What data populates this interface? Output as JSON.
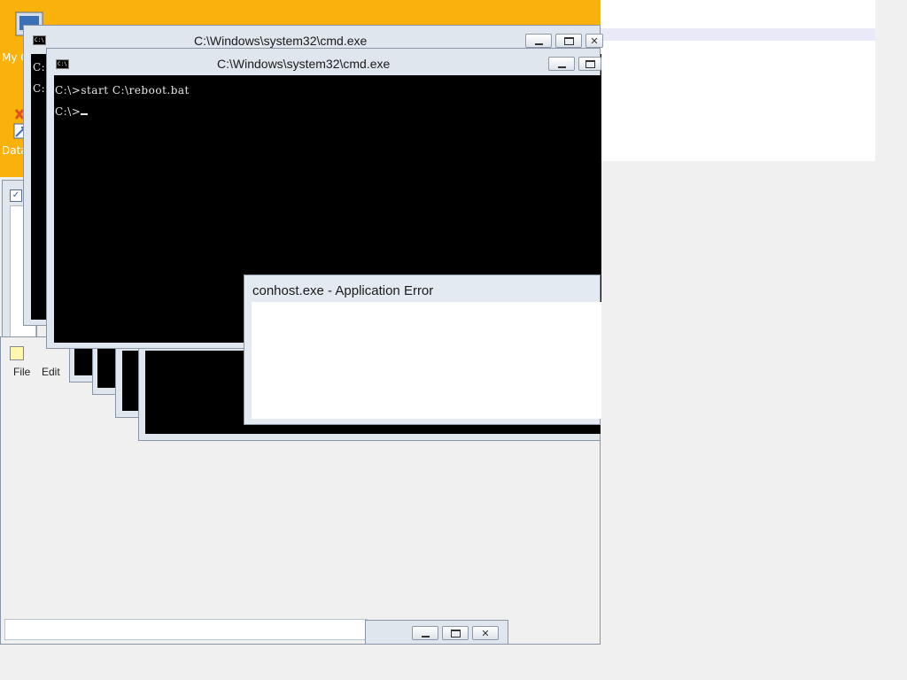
{
  "desktop": {
    "icons": [
      {
        "label": "My C",
        "icon": "my-computer-icon"
      },
      {
        "label": "Data",
        "icon": "shortcut-icon"
      }
    ]
  },
  "windows": {
    "cmd_back": {
      "title": "C:\\Windows\\system32\\cmd.exe",
      "lines": [
        "C:",
        "C:"
      ]
    },
    "cmd_front": {
      "title": "C:\\Windows\\system32\\cmd.exe",
      "lines": [
        "C:\\>start C:\\reboot.bat",
        "C:\\>"
      ]
    },
    "error_dialog": {
      "title": "conhost.exe - Application Error"
    },
    "notepad": {
      "menu": [
        "File",
        "Edit"
      ]
    }
  },
  "colors": {
    "desktop": "#f9b10c",
    "console": "#000000",
    "chrome": "#dfe6ee"
  }
}
